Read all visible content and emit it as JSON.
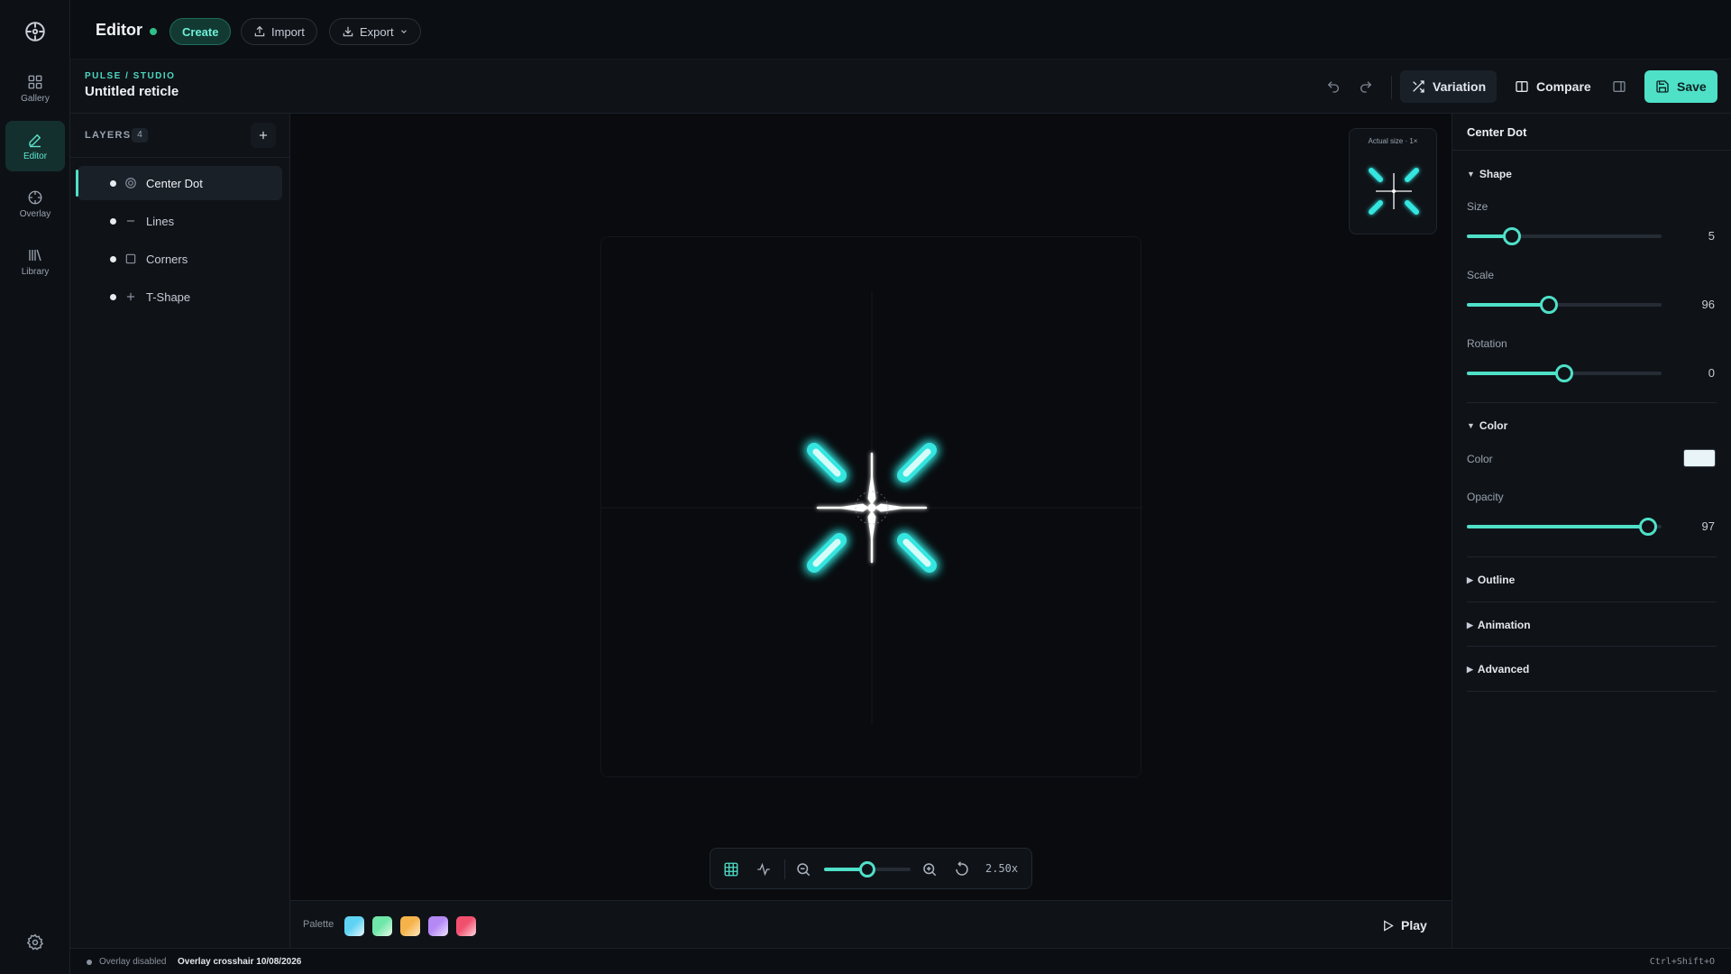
{
  "app": {
    "title": "Editor",
    "create_label": "Create",
    "import_label": "Import",
    "export_label": "Export"
  },
  "rail": {
    "items": [
      {
        "label": "Gallery",
        "icon": "grid-icon"
      },
      {
        "label": "Editor",
        "icon": "pencil-icon",
        "active": true
      },
      {
        "label": "Overlay",
        "icon": "crosshair-icon"
      },
      {
        "label": "Library",
        "icon": "library-icon"
      }
    ]
  },
  "header": {
    "breadcrumb": "PULSE / STUDIO",
    "doc_title": "Untitled reticle",
    "variation_label": "Variation",
    "compare_label": "Compare",
    "save_label": "Save"
  },
  "layers": {
    "heading": "LAYERS",
    "count": "4",
    "items": [
      {
        "label": "Center Dot",
        "icon": "target-icon",
        "selected": true
      },
      {
        "label": "Lines",
        "icon": "line-icon"
      },
      {
        "label": "Corners",
        "icon": "square-icon"
      },
      {
        "label": "T-Shape",
        "icon": "plus-icon"
      }
    ]
  },
  "canvas": {
    "preview_label": "Actual size · 1×",
    "zoom_label": "2.50x",
    "zoom_level": 0.5
  },
  "palette": {
    "label": "Palette",
    "swatches": [
      {
        "from": "#5fd3f3",
        "to": "#e8f7ff"
      },
      {
        "from": "#6ee7a8",
        "to": "#e9fbe8"
      },
      {
        "from": "#f5b34a",
        "to": "#ffe8c2"
      },
      {
        "from": "#b589f5",
        "to": "#f0e4ff"
      },
      {
        "from": "#f0506e",
        "to": "#ffd9df"
      }
    ],
    "play_label": "Play"
  },
  "properties": {
    "title": "Center Dot",
    "shape": {
      "heading": "Shape",
      "size": {
        "label": "Size",
        "value": "5",
        "fraction": 0.23
      },
      "scale": {
        "label": "Scale",
        "value": "96",
        "fraction": 0.42
      },
      "rotation": {
        "label": "Rotation",
        "value": "0",
        "fraction": 0.5
      }
    },
    "color": {
      "heading": "Color",
      "color_label": "Color",
      "color_value": "#e8f4f8",
      "opacity": {
        "label": "Opacity",
        "value": "97",
        "fraction": 0.93
      }
    },
    "collapsed_sections": [
      "Outline",
      "Animation",
      "Advanced"
    ]
  },
  "status": {
    "state": "Overlay disabled",
    "info": "Overlay crosshair 10/08/2026",
    "shortcut": "Ctrl+Shift+O"
  },
  "colors": {
    "accent": "#4fe0c8",
    "glow": "#35e6e0",
    "background": "#090b0e"
  }
}
